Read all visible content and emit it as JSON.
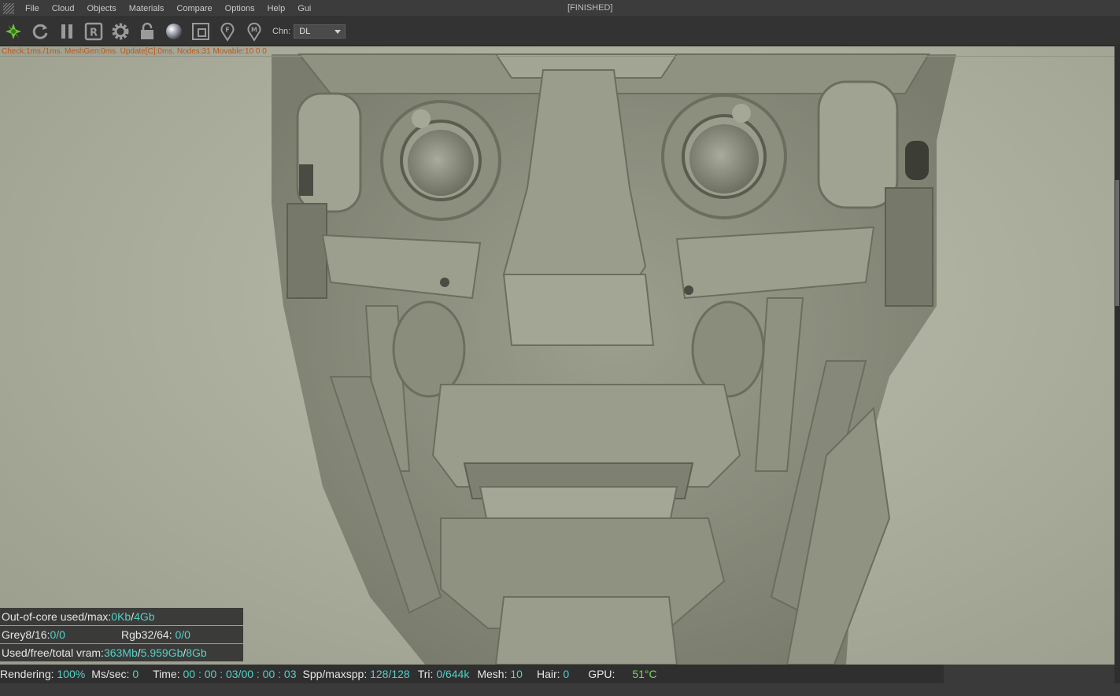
{
  "menubar": {
    "items": [
      "File",
      "Cloud",
      "Objects",
      "Materials",
      "Compare",
      "Options",
      "Help",
      "Gui"
    ],
    "state": "[FINISHED]"
  },
  "toolbar": {
    "icons": [
      "octane-logo-icon",
      "refresh-icon",
      "pause-icon",
      "region-render-icon",
      "settings-gear-icon",
      "lock-icon",
      "material-ball-icon",
      "clay-mode-icon",
      "focus-pick-icon",
      "material-pick-icon"
    ],
    "chn_label": "Chn:",
    "chn_value": "DL"
  },
  "viewport": {
    "check_line": "Check:1ms./1ms. MeshGen:0ms. Update[C]:0ms. Nodes:31 Movable:10  0 0"
  },
  "stats": {
    "ooc_label": "Out-of-core used/max:",
    "ooc_used": "0Kb",
    "ooc_sep": "/",
    "ooc_max": "4Gb",
    "grey_label": "Grey8/16: ",
    "grey_value": "0/0",
    "rgb_label": "Rgb32/64: ",
    "rgb_value": "0/0",
    "vram_label": "Used/free/total vram: ",
    "vram_used": "363Mb",
    "vram_free": "5.959Gb",
    "vram_total": "8Gb"
  },
  "statusbar": {
    "rendering_label": "Rendering: ",
    "rendering_value": "100%",
    "mssec_label": "Ms/sec: ",
    "mssec_value": "0",
    "time_label": "Time: ",
    "time_value": "00 : 00 : 03/00 : 00 : 03",
    "spp_label": "Spp/maxspp: ",
    "spp_value": "128/128",
    "tri_label": "Tri: ",
    "tri_value": "0/644k",
    "mesh_label": "Mesh: ",
    "mesh_value": "10",
    "hair_label": "Hair: ",
    "hair_value": "0",
    "gpu_label": "GPU: ",
    "gpu_value": "51°C"
  },
  "colors": {
    "accent_value": "#52d1c7",
    "check_text": "#b7591d",
    "render_bg": "#a9ab9b",
    "clay": "#8b8d7d"
  }
}
